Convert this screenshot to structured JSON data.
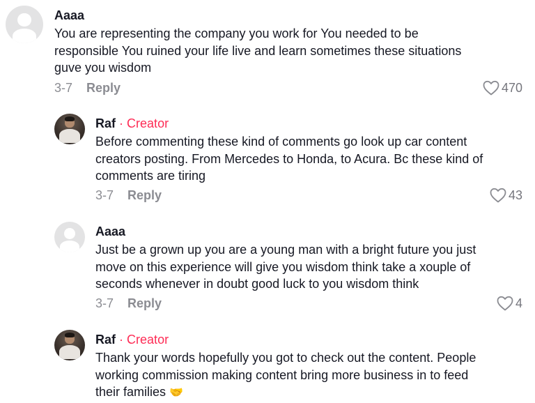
{
  "colors": {
    "creator_accent": "#fe2c55",
    "text": "#161823",
    "muted": "#8a8b91"
  },
  "comments": [
    {
      "author": "Aaaa",
      "avatar": "default-avatar",
      "is_creator": false,
      "text": "You are representing the company you work for You needed to be\nresponsible You ruined your life live and learn sometimes these situations\nguve you wisdom",
      "date": "3-7",
      "reply_label": "Reply",
      "likes": "470"
    },
    {
      "author": "Raf",
      "separator": "·",
      "badge": "Creator",
      "avatar": "creator-avatar",
      "is_creator": true,
      "text": "Before commenting these kind of comments go look up car content\ncreators posting. From Mercedes to Honda, to Acura. Bc these kind of\ncomments are tiring",
      "date": "3-7",
      "reply_label": "Reply",
      "likes": "43"
    },
    {
      "author": "Aaaa",
      "avatar": "default-avatar",
      "is_creator": false,
      "text": "Just be a grown up you are a young man with a bright future you just\nmove on this experience will give you wisdom think take a xouple of\nseconds whenever in doubt good luck to you wisdom think",
      "date": "3-7",
      "reply_label": "Reply",
      "likes": "4"
    },
    {
      "author": "Raf",
      "separator": "·",
      "badge": "Creator",
      "avatar": "creator-avatar",
      "is_creator": true,
      "text": "Thank your words hopefully you got to check out the content. People\nworking commission making content bring more business in to feed\ntheir families",
      "emoji": "🤝",
      "date": "",
      "reply_label": "",
      "likes": ""
    }
  ]
}
